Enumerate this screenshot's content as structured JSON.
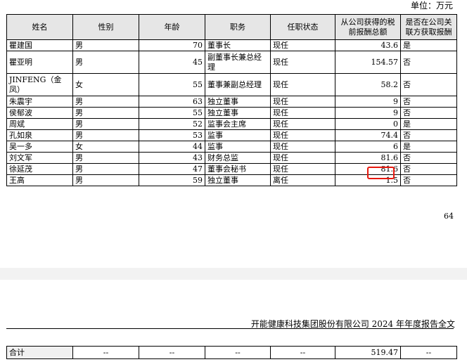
{
  "unit_label": "单位：万元",
  "headers": [
    "姓名",
    "性别",
    "年龄",
    "职务",
    "任职状态",
    "从公司获得的税前报酬总额",
    "是否在公司关联方获取报酬"
  ],
  "rows": [
    {
      "name": "瞿建国",
      "gender": "男",
      "age": "70",
      "title": "董事长",
      "status": "现任",
      "pay": "43.6",
      "related": "是"
    },
    {
      "name": "瞿亚明",
      "gender": "男",
      "age": "45",
      "title": "副董事长兼总经理",
      "status": "现任",
      "pay": "154.57",
      "related": "否"
    },
    {
      "name": "JINFENG（金凤）",
      "gender": "女",
      "age": "55",
      "title": "董事兼副总经理",
      "status": "现任",
      "pay": "58.2",
      "related": "否"
    },
    {
      "name": "朱震宇",
      "gender": "男",
      "age": "63",
      "title": "独立董事",
      "status": "现任",
      "pay": "9",
      "related": "否"
    },
    {
      "name": "侯郁波",
      "gender": "男",
      "age": "55",
      "title": "独立董事",
      "status": "现任",
      "pay": "9",
      "related": "否"
    },
    {
      "name": "周斌",
      "gender": "男",
      "age": "52",
      "title": "监事会主席",
      "status": "现任",
      "pay": "0",
      "related": "是"
    },
    {
      "name": "孔如泉",
      "gender": "男",
      "age": "53",
      "title": "监事",
      "status": "现任",
      "pay": "74.4",
      "related": "否"
    },
    {
      "name": "吴一多",
      "gender": "女",
      "age": "44",
      "title": "监事",
      "status": "现任",
      "pay": "6",
      "related": "是"
    },
    {
      "name": "刘文军",
      "gender": "男",
      "age": "43",
      "title": "财务总监",
      "status": "现任",
      "pay": "81.6",
      "related": "否"
    },
    {
      "name": "徐延茂",
      "gender": "男",
      "age": "47",
      "title": "董事会秘书",
      "status": "现任",
      "pay": "81.6",
      "related": "否"
    },
    {
      "name": "王高",
      "gender": "男",
      "age": "59",
      "title": "独立董事",
      "status": "离任",
      "pay": "1.5",
      "related": "否"
    }
  ],
  "page_number": "64",
  "report_title": "开能健康科技集团股份有限公司 2024 年年度报告全文",
  "total_row": {
    "label": "合计",
    "gender": "--",
    "age": "--",
    "title": "--",
    "status": "--",
    "pay": "519.47",
    "related": "--"
  }
}
